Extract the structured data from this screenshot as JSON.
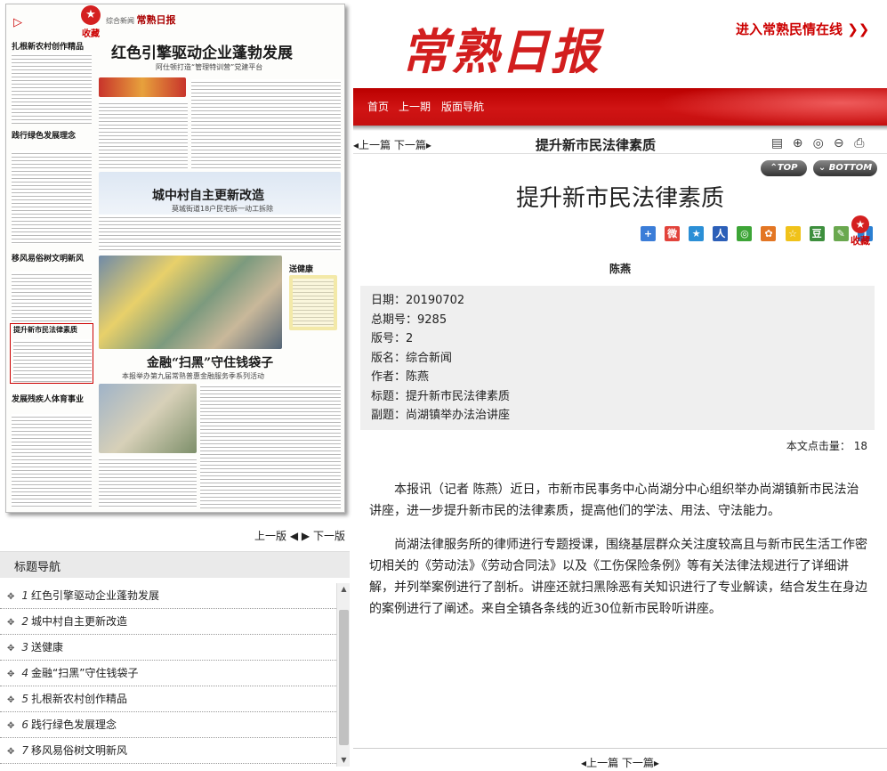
{
  "favorite": {
    "label": "收藏"
  },
  "paper": {
    "masthead_section": "综合新闻",
    "masthead_name": "常熟日报",
    "headlines": [
      "红色引擎驱动企业蓬勃发展",
      "城中村自主更新改造",
      "金融“扫黑”守住钱袋子"
    ],
    "subheads": [
      "阿仕顿打造“管理特训营”党建平台",
      "莫城街道18户民宅拆一动工拆除",
      "本报举办第九届常熟普惠金融服务季系列活动"
    ],
    "left_heads": [
      "扎根新农村创作精品",
      "践行绿色发展理念",
      "移风易俗树文明新风",
      "提升新市民法律素质",
      "发展残疾人体育事业"
    ],
    "box_head": "送健康"
  },
  "page_nav": {
    "prev": "上一版",
    "next": "下一版"
  },
  "title_nav": {
    "heading": "标题导航",
    "items": [
      {
        "n": "1",
        "title": "红色引擎驱动企业蓬勃发展"
      },
      {
        "n": "2",
        "title": "城中村自主更新改造"
      },
      {
        "n": "3",
        "title": "送健康"
      },
      {
        "n": "4",
        "title": "金融“扫黑”守住钱袋子"
      },
      {
        "n": "5",
        "title": "扎根新农村创作精品"
      },
      {
        "n": "6",
        "title": "践行绿色发展理念"
      },
      {
        "n": "7",
        "title": "移风易俗树文明新风"
      }
    ]
  },
  "header": {
    "logo": "常熟日报",
    "minqing_link": "进入常熟民情在线 ❯❯",
    "nav": [
      "首页",
      "上一期",
      "版面导航"
    ]
  },
  "article_nav": {
    "prev": "上一篇",
    "next": "下一篇"
  },
  "article": {
    "bar_title": "提升新市民法律素质",
    "title": "提升新市民法律素质",
    "author": "陈燕",
    "top_label": "TOP",
    "bottom_label": "BOTTOM",
    "meta": [
      {
        "k": "日期：",
        "v": "20190702"
      },
      {
        "k": "总期号：",
        "v": "9285"
      },
      {
        "k": "版号：",
        "v": "2"
      },
      {
        "k": "版名：",
        "v": "综合新闻"
      },
      {
        "k": "作者：",
        "v": "陈燕"
      },
      {
        "k": "标题：",
        "v": "提升新市民法律素质"
      },
      {
        "k": "副题：",
        "v": "尚湖镇举办法治讲座"
      }
    ],
    "wordcount_label": "本文点击量：",
    "wordcount": "18",
    "paragraphs": [
      "本报讯（记者 陈燕）近日，市新市民事务中心尚湖分中心组织举办尚湖镇新市民法治讲座，进一步提升新市民的法律素质，提高他们的学法、用法、守法能力。",
      "尚湖法律服务所的律师进行专题授课，围绕基层群众关注度较高且与新市民生活工作密切相关的《劳动法》《劳动合同法》以及《工伤保险条例》等有关法律法规进行了详细讲解，并列举案例进行了剖析。讲座还就扫黑除恶有关知识进行了专业解读，结合发生在身边的案例进行了阐述。来自全镇各条线的近30位新市民聆听讲座。"
    ]
  },
  "colors": {
    "brand_red": "#d21e1e",
    "nav_red": "#c50f0f"
  }
}
